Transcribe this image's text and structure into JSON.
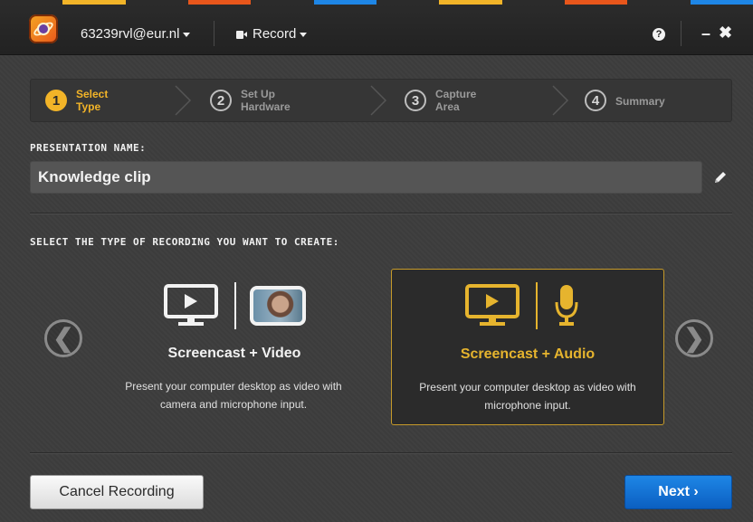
{
  "colors": {
    "accent": "#f2b428",
    "primary_button": "#1372d6",
    "background": "#3d3d3d",
    "titlebar": "#262626",
    "top_strip": [
      "#f2b428",
      "#3d3d3d",
      "#e8561b",
      "#3d3d3d",
      "#1e86e6",
      "#3d3d3d",
      "#f2b428",
      "#3d3d3d"
    ]
  },
  "titlebar": {
    "logo_icon": "app-logo",
    "account": "63239rvl@eur.nl",
    "record_menu": "Record",
    "help_icon": "?",
    "minimize": "–",
    "close": "✖"
  },
  "steps": [
    {
      "number": "1",
      "line1": "Select",
      "line2": "Type",
      "active": true
    },
    {
      "number": "2",
      "line1": "Set Up",
      "line2": "Hardware",
      "active": false
    },
    {
      "number": "3",
      "line1": "Capture",
      "line2": "Area",
      "active": false
    },
    {
      "number": "4",
      "line1": "Summary",
      "line2": "",
      "active": false
    }
  ],
  "presentation": {
    "label": "PRESENTATION NAME:",
    "value": "Knowledge clip",
    "edit_icon": "pencil-icon"
  },
  "recording_type": {
    "label": "SELECT THE TYPE OF RECORDING YOU WANT TO CREATE:",
    "options": [
      {
        "title": "Screencast + Video",
        "desc_line1": "Present your computer desktop as video with",
        "desc_line2": "camera and microphone input.",
        "selected": false,
        "icons": [
          "monitor-icon",
          "webcam-thumbnail"
        ]
      },
      {
        "title": "Screencast + Audio",
        "desc_line1": "Present your computer desktop as video with",
        "desc_line2": "microphone input.",
        "selected": true,
        "icons": [
          "monitor-icon",
          "microphone-icon"
        ]
      }
    ],
    "prev_arrow": "❮",
    "next_arrow": "❯"
  },
  "footer": {
    "cancel_label": "Cancel Recording",
    "next_label": "Next ›"
  }
}
